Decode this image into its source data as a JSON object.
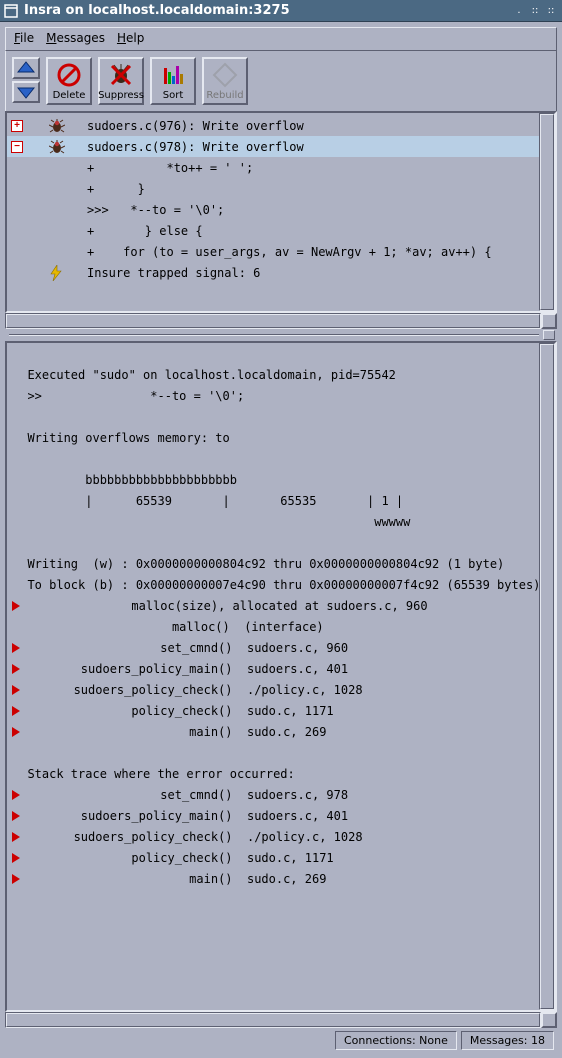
{
  "window": {
    "title": "Insra on localhost.localdomain:3275"
  },
  "menubar": {
    "file": "File",
    "messages": "Messages",
    "help": "Help"
  },
  "toolbar": {
    "delete": "Delete",
    "suppress": "Suppress",
    "sort": "Sort",
    "rebuild": "Rebuild"
  },
  "log": {
    "rows": [
      {
        "expand": "+",
        "icon": "bug",
        "text": "sudoers.c(976): Write overflow"
      },
      {
        "expand": "-",
        "icon": "bug",
        "text": "sudoers.c(978): Write overflow",
        "selected": true
      },
      {
        "expand": "",
        "icon": "",
        "text": "+          *to++ = ' ';"
      },
      {
        "expand": "",
        "icon": "",
        "text": "+      }"
      },
      {
        "expand": "",
        "icon": "",
        "text": ">>>   *--to = '\\0';"
      },
      {
        "expand": "",
        "icon": "",
        "text": "+       } else {"
      },
      {
        "expand": "",
        "icon": "",
        "text": "+    for (to = user_args, av = NewArgv + 1; *av; av++) {"
      },
      {
        "expand": "",
        "icon": "bolt",
        "text": "Insure trapped signal: 6"
      }
    ]
  },
  "detail_lines": [
    "  Executed \"sudo\" on localhost.localdomain, pid=75542",
    "  >>               *--to = '\\0';",
    "",
    "  Writing overflows memory: to",
    "",
    "          bbbbbbbbbbbbbbbbbbbbb",
    "          |      65539       |       65535       | 1 |",
    "                                                  wwwww",
    "",
    "  Writing  (w) : 0x0000000000804c92 thru 0x0000000000804c92 (1 byte)",
    "  To block (b) : 0x00000000007e4c90 thru 0x00000000007f4c92 (65539 bytes)",
    "T               malloc(size), allocated at sudoers.c, 960",
    "                      malloc()  (interface)",
    "T                   set_cmnd()  sudoers.c, 960",
    "T        sudoers_policy_main()  sudoers.c, 401",
    "T       sudoers_policy_check()  ./policy.c, 1028",
    "T               policy_check()  sudo.c, 1171",
    "T                       main()  sudo.c, 269",
    "",
    "  Stack trace where the error occurred:",
    "T                   set_cmnd()  sudoers.c, 978",
    "T        sudoers_policy_main()  sudoers.c, 401",
    "T       sudoers_policy_check()  ./policy.c, 1028",
    "T               policy_check()  sudo.c, 1171",
    "T                       main()  sudo.c, 269"
  ],
  "status": {
    "connections": "Connections: None",
    "messages": "Messages: 18"
  }
}
